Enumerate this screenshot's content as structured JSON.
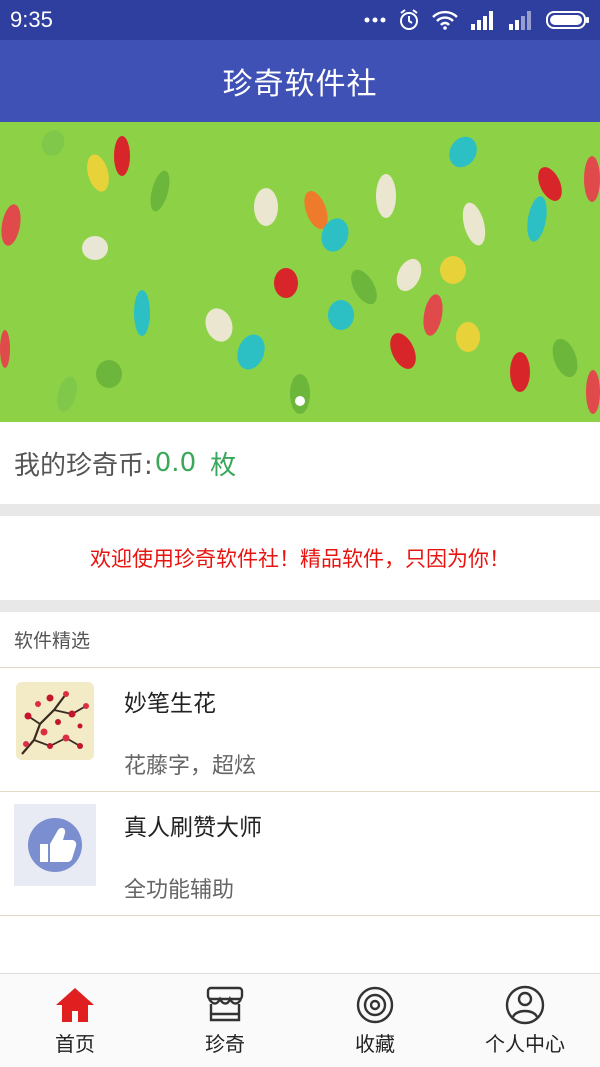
{
  "status_bar": {
    "time": "9:35"
  },
  "app_bar": {
    "title": "珍奇软件社"
  },
  "coins": {
    "label": "我的珍奇币:",
    "value": "0.0",
    "unit": "枚"
  },
  "welcome": {
    "text": "欢迎使用珍奇软件社！精品软件，只因为你！"
  },
  "section": {
    "title": "软件精选"
  },
  "apps": [
    {
      "name": "妙笔生花",
      "desc": "花藤字，超炫",
      "icon": "plum-blossom-painting-icon"
    },
    {
      "name": "真人刷赞大师",
      "desc": "全功能辅助",
      "icon": "thumbs-up-icon"
    }
  ],
  "nav": [
    {
      "label": "首页",
      "icon": "home-icon",
      "active": true
    },
    {
      "label": "珍奇",
      "icon": "store-icon",
      "active": false
    },
    {
      "label": "收藏",
      "icon": "target-icon",
      "active": false
    },
    {
      "label": "个人中心",
      "icon": "user-icon",
      "active": false
    }
  ],
  "colors": {
    "primary": "#3f51b5",
    "status_bar": "#2f3f9f",
    "accent_green": "#3aa75a",
    "welcome_red": "#e8140f",
    "nav_active": "#e02020"
  },
  "banner": {
    "page_indicator": {
      "count": 1,
      "current": 1
    }
  }
}
